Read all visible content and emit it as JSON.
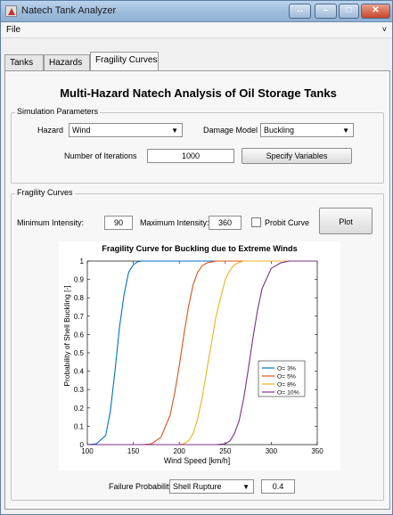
{
  "window": {
    "title": "Natech Tank Analyzer",
    "controls": {
      "restore": "↔",
      "minimize": "–",
      "maximize": "□",
      "close": "✕"
    }
  },
  "menu": {
    "file": "File",
    "overflow": "˅"
  },
  "tabs": [
    {
      "label": "Tanks",
      "active": false
    },
    {
      "label": "Hazards",
      "active": false
    },
    {
      "label": "Fragility Curves",
      "active": true
    }
  ],
  "main": {
    "heading": "Multi-Hazard Natech Analysis of Oil Storage Tanks",
    "simulation": {
      "group_title": "Simulation Parameters",
      "hazard_label": "Hazard",
      "hazard_value": "Wind",
      "damage_model_label": "Damage Model",
      "damage_model_value": "Buckling",
      "iterations_label": "Number of Iterations",
      "iterations_value": "1000",
      "specify_button": "Specify Variables"
    },
    "fragility": {
      "group_title": "Fragility Curves",
      "min_label": "Minimum Intensity:",
      "min_value": "90",
      "max_label": "Maximum Intensity:",
      "max_value": "360",
      "probit_label": "Probit Curve",
      "probit_checked": false,
      "plot_button": "Plot"
    },
    "failure": {
      "label": "Failure Probability:",
      "select_value": "Shell Rupture",
      "value": "0.4"
    }
  },
  "chart_data": {
    "type": "line",
    "title": "Fragility Curve for Buckling due to Extreme Winds",
    "xlabel": "Wind Speed [km/h]",
    "ylabel": "Probability of Shell Buckling [-]",
    "xlim": [
      100,
      350
    ],
    "ylim": [
      0,
      1
    ],
    "xticks": [
      100,
      150,
      200,
      250,
      300,
      350
    ],
    "yticks": [
      0,
      0.1,
      0.2,
      0.3,
      0.4,
      0.5,
      0.6,
      0.7,
      0.8,
      0.9,
      1
    ],
    "legend_position": "lower-right",
    "grid": false,
    "x": [
      100,
      110,
      120,
      125,
      130,
      135,
      140,
      145,
      150,
      155,
      160,
      170,
      180,
      190,
      195,
      200,
      205,
      210,
      215,
      220,
      225,
      230,
      240,
      250,
      255,
      260,
      265,
      270,
      275,
      280,
      285,
      290,
      300,
      310,
      320,
      330,
      340,
      350
    ],
    "series": [
      {
        "name": "O= 3%",
        "color": "#0072BD",
        "values": [
          0,
          0.005,
          0.05,
          0.18,
          0.4,
          0.64,
          0.82,
          0.94,
          0.98,
          0.997,
          1,
          1,
          1,
          1,
          1,
          1,
          1,
          1,
          1,
          1,
          1,
          1,
          1,
          1,
          1,
          1,
          1,
          1,
          1,
          1,
          1,
          1,
          1,
          1,
          1,
          1,
          1,
          1
        ]
      },
      {
        "name": "O= 5%",
        "color": "#D95319",
        "values": [
          0,
          0,
          0,
          0,
          0,
          0,
          0,
          0,
          0,
          0,
          0,
          0.005,
          0.04,
          0.16,
          0.28,
          0.43,
          0.6,
          0.75,
          0.87,
          0.94,
          0.975,
          0.99,
          1,
          1,
          1,
          1,
          1,
          1,
          1,
          1,
          1,
          1,
          1,
          1,
          1,
          1,
          1,
          1
        ]
      },
      {
        "name": "O= 8%",
        "color": "#EDB120",
        "values": [
          0,
          0,
          0,
          0,
          0,
          0,
          0,
          0,
          0,
          0,
          0,
          0,
          0,
          0,
          0,
          0,
          0.005,
          0.02,
          0.06,
          0.14,
          0.26,
          0.41,
          0.7,
          0.9,
          0.95,
          0.98,
          0.993,
          1,
          1,
          1,
          1,
          1,
          1,
          1,
          1,
          1,
          1,
          1
        ]
      },
      {
        "name": "O= 10%",
        "color": "#7E2F8E",
        "values": [
          0,
          0,
          0,
          0,
          0,
          0,
          0,
          0,
          0,
          0,
          0,
          0,
          0,
          0,
          0,
          0,
          0,
          0,
          0,
          0,
          0,
          0,
          0,
          0.005,
          0.02,
          0.06,
          0.13,
          0.25,
          0.41,
          0.58,
          0.73,
          0.85,
          0.96,
          0.99,
          1,
          1,
          1,
          1
        ]
      }
    ]
  }
}
